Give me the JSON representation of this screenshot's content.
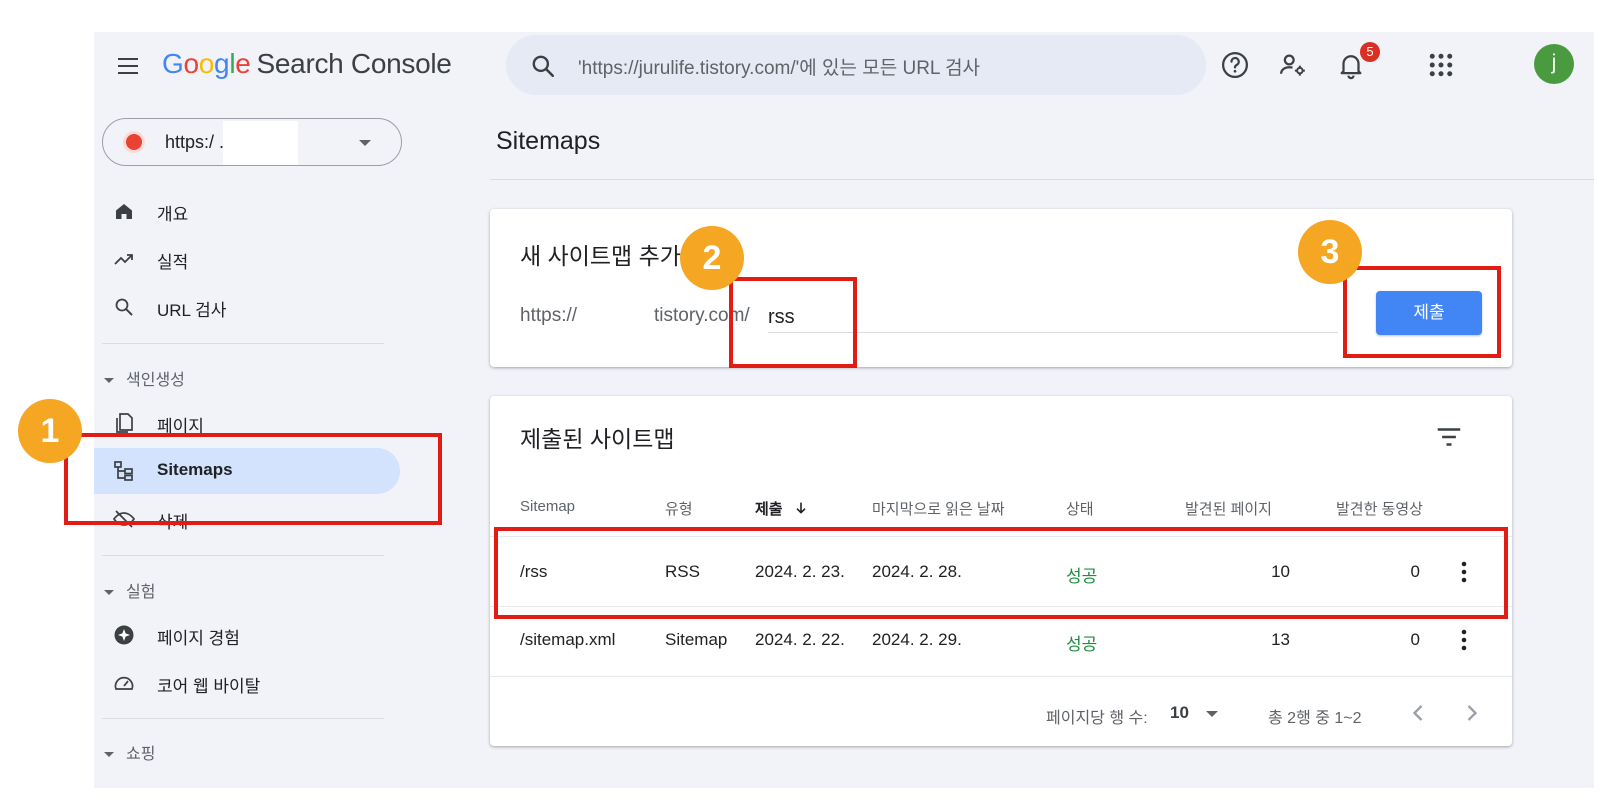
{
  "brand": {
    "google_letters": [
      "G",
      "o",
      "o",
      "g",
      "l",
      "e"
    ],
    "product": "Search Console"
  },
  "search": {
    "text": "'https://jurulife.tistory.com/'에 있는 모든 URL 검사"
  },
  "toolbar": {
    "help_icon": "help-icon",
    "admin_icon": "users-settings-icon",
    "notifications_icon": "bell-icon",
    "notifications_count": "5",
    "apps_icon": "apps-grid-icon",
    "avatar_letter": "j"
  },
  "property_selector": {
    "text": "https:/               .tistor..."
  },
  "sidebar": {
    "items": [
      {
        "label": "개요",
        "icon": "home-icon"
      },
      {
        "label": "실적",
        "icon": "trending-up-icon"
      },
      {
        "label": "URL 검사",
        "icon": "search-icon"
      },
      {
        "label": "페이지",
        "icon": "pages-icon"
      },
      {
        "label": "Sitemaps",
        "icon": "sitemap-icon"
      },
      {
        "label": "삭제",
        "icon": "removals-icon"
      },
      {
        "label": "페이지 경험",
        "icon": "page-experience-icon"
      },
      {
        "label": "코어 웹 바이탈",
        "icon": "speedometer-icon"
      }
    ],
    "sections": {
      "indexing": "색인생성",
      "experience": "실험",
      "shopping": "쇼핑"
    }
  },
  "main": {
    "title": "Sitemaps",
    "add_card": {
      "title": "새 사이트맵 추가",
      "prefix_a": "https://",
      "prefix_b": "tistory.com/",
      "input_value": "rss",
      "submit_label": "제출"
    },
    "submitted_card": {
      "title": "제출된 사이트맵",
      "filter_icon": "filter-icon",
      "columns": [
        "Sitemap",
        "유형",
        "제출",
        "마지막으로 읽은 날짜",
        "상태",
        "발견된 페이지",
        "발견한 동영상"
      ],
      "sorted_column_index": 2,
      "sort_direction": "descending",
      "rows": [
        {
          "sitemap": "/rss",
          "type": "RSS",
          "submitted": "2024. 2. 23.",
          "last_read": "2024. 2. 28.",
          "status": "성공",
          "pages": "10",
          "videos": "0"
        },
        {
          "sitemap": "/sitemap.xml",
          "type": "Sitemap",
          "submitted": "2024. 2. 22.",
          "last_read": "2024. 2. 29.",
          "status": "성공",
          "pages": "13",
          "videos": "0"
        }
      ],
      "pagination": {
        "rows_per_page_label": "페이지당 행 수:",
        "rows_per_page": "10",
        "range": "총 2행 중 1~2"
      }
    }
  },
  "annotations": {
    "badges": [
      "1",
      "2",
      "3"
    ],
    "badge_color": "#f5a623",
    "box_color": "#e01c14"
  },
  "colors": {
    "accent": "#4285f4",
    "success": "#1e8e3e",
    "nav_active": "#d3e3fd",
    "background": "#f1f3f9"
  }
}
